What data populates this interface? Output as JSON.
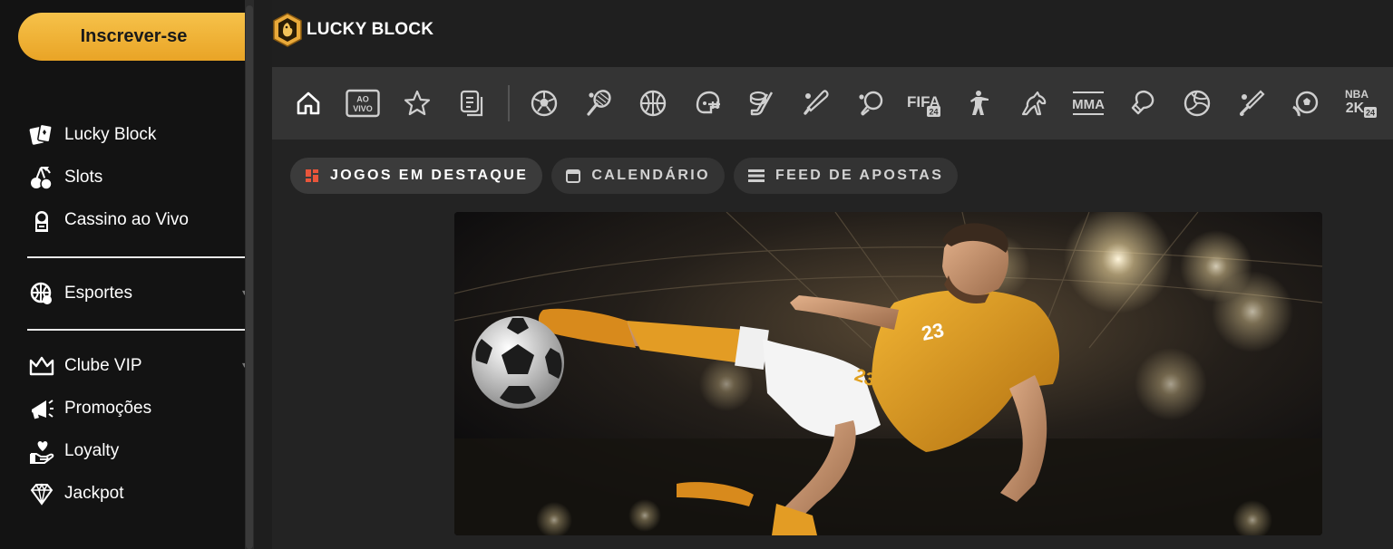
{
  "sidebar": {
    "signup_label": "Inscrever-se",
    "groups": [
      {
        "items": [
          {
            "label": "Lucky Block",
            "icon": "cards-icon"
          },
          {
            "label": "Slots",
            "icon": "cherries-icon"
          },
          {
            "label": "Cassino ao Vivo",
            "icon": "dealer-icon"
          }
        ]
      },
      {
        "items": [
          {
            "label": "Esportes",
            "icon": "sports-ball-icon"
          }
        ]
      },
      {
        "items": [
          {
            "label": "Clube VIP",
            "icon": "crown-icon"
          },
          {
            "label": "Promoções",
            "icon": "megaphone-icon"
          },
          {
            "label": "Loyalty",
            "icon": "heart-hand-icon"
          },
          {
            "label": "Jackpot",
            "icon": "diamond-icon"
          }
        ]
      }
    ]
  },
  "header": {
    "brand": "LUCKY BLOCK"
  },
  "sportsbar": {
    "ao_vivo_top": "AO",
    "ao_vivo_bottom": "VIVO",
    "fifa_label": "FIFA",
    "fifa_badge": "24",
    "mma_label": "MMA",
    "nba_top": "NBA",
    "nba_mid": "2K",
    "nba_badge": "24",
    "icons": [
      "home-icon",
      "ao-vivo-icon",
      "star-icon",
      "betslip-icon",
      "soccer-icon",
      "tennis-icon",
      "basketball-icon",
      "american-football-icon",
      "ice-hockey-icon",
      "baseball-icon",
      "table-tennis-icon",
      "fifa-icon",
      "counter-strike-icon",
      "horse-racing-icon",
      "mma-icon",
      "boxing-icon",
      "volleyball-icon",
      "cricket-icon",
      "rugby-icon",
      "nba2k-icon"
    ]
  },
  "tabs": [
    {
      "label": "JOGOS EM DESTAQUE",
      "icon": "featured-grid-icon",
      "active": true
    },
    {
      "label": "CALENDÁRIO",
      "icon": "calendar-icon",
      "active": false
    },
    {
      "label": "FEED DE APOSTAS",
      "icon": "feed-icon",
      "active": false
    }
  ],
  "banner": {
    "jersey_number": "23"
  },
  "colors": {
    "accent": "#f0b43a",
    "active_tab_icon": "#e8553b"
  }
}
